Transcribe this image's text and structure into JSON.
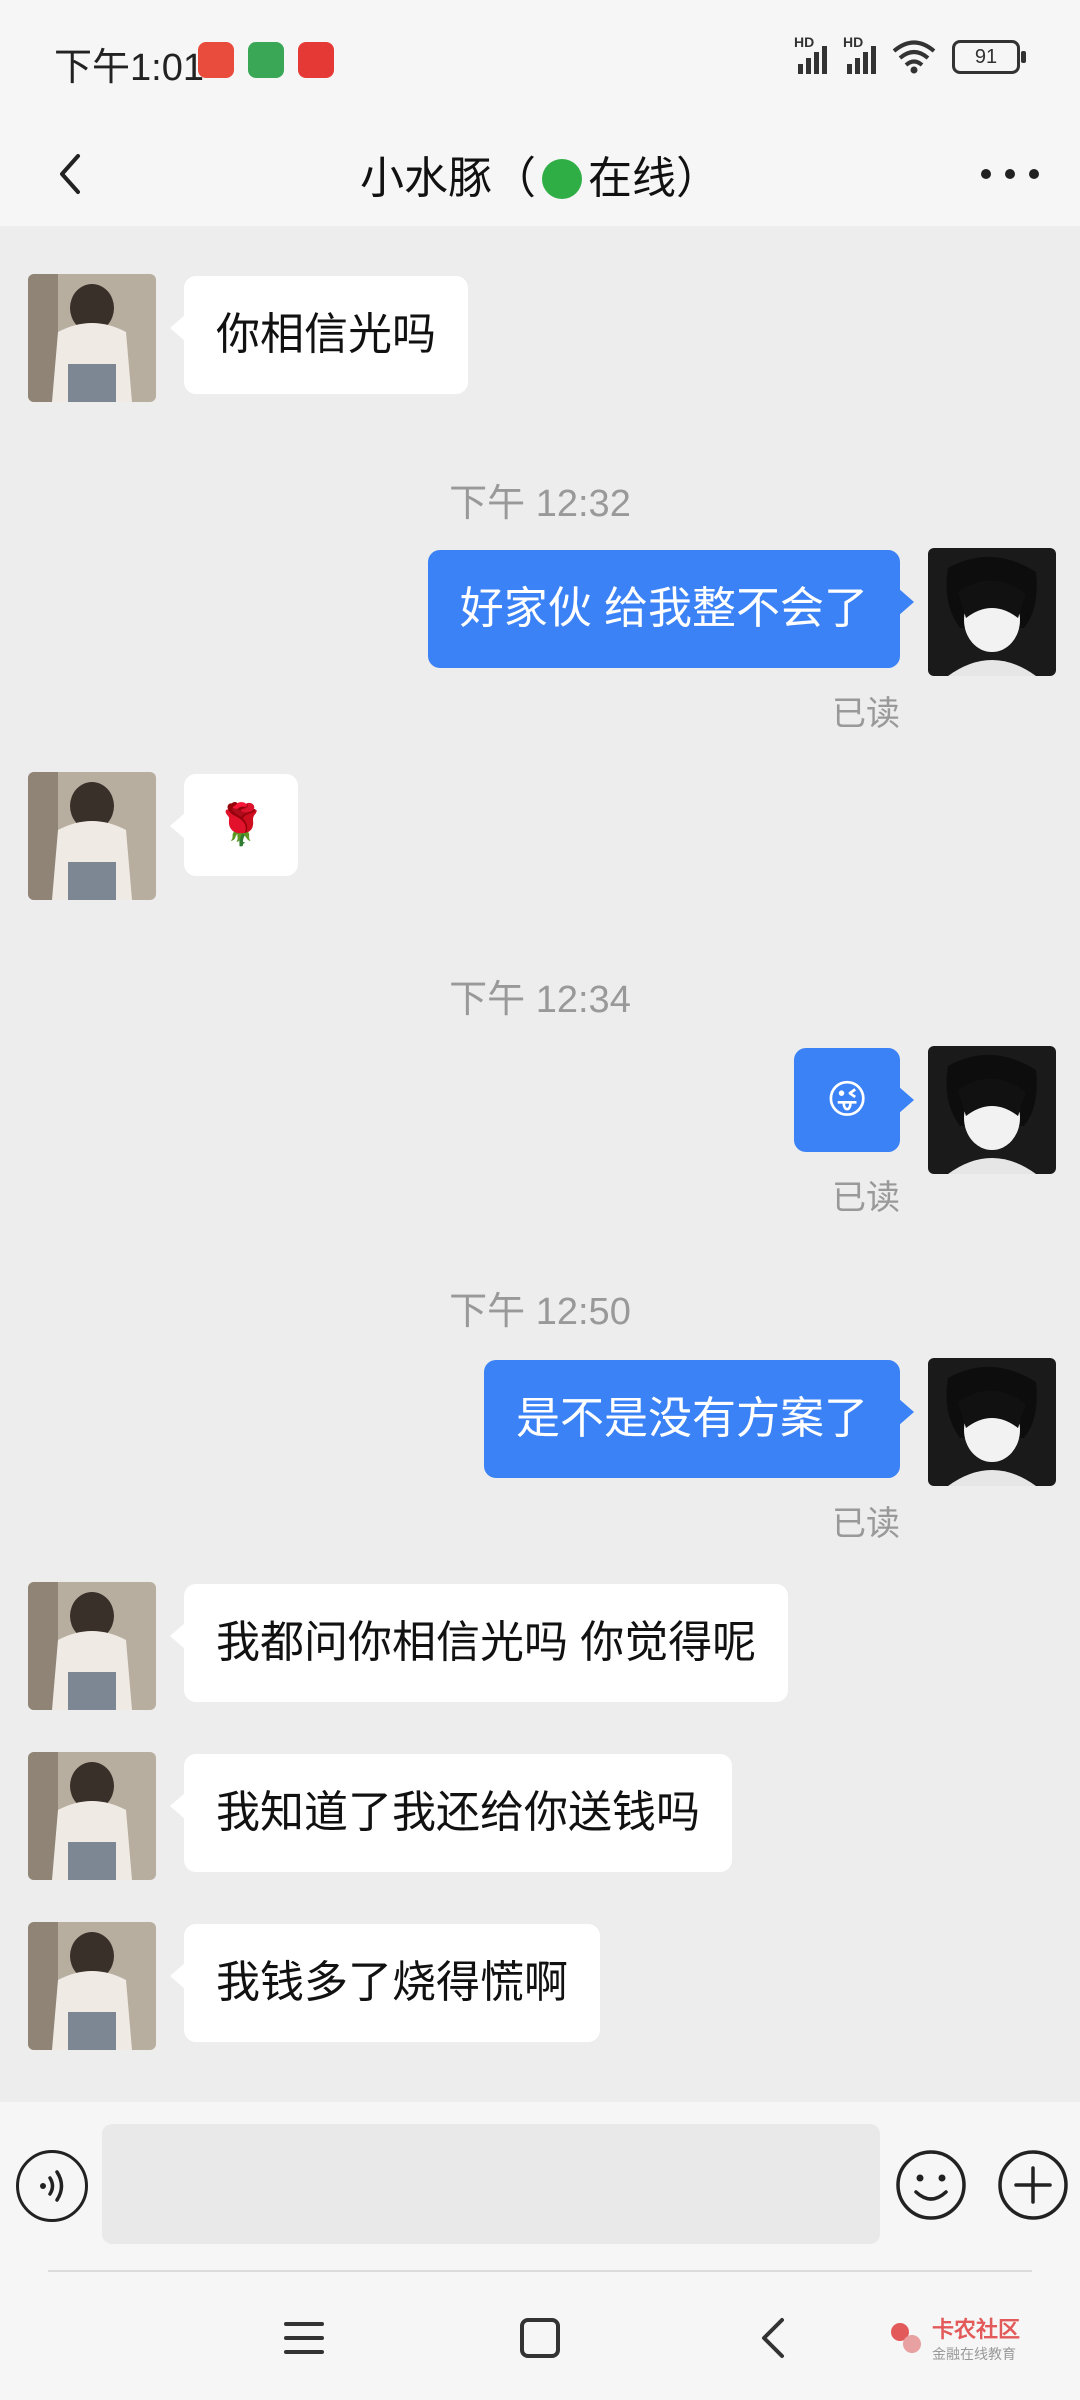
{
  "status_bar": {
    "time": "下午1:01",
    "app_icons": [
      "pinduoduo-icon",
      "app-icon",
      "search-app-icon"
    ],
    "signal1_label": "HD",
    "signal2_label": "HD",
    "battery_level": "91"
  },
  "header": {
    "name": "小水豚",
    "open_paren": "（",
    "status": "在线",
    "close_paren": "）",
    "status_color": "#2fae45"
  },
  "messages": [
    {
      "side": "left",
      "type": "text",
      "text": "你相信光吗"
    },
    {
      "timestamp": "下午 12:32"
    },
    {
      "side": "right",
      "type": "text",
      "text": "好家伙 给我整不会了",
      "read": "已读"
    },
    {
      "side": "left",
      "type": "emoji",
      "text": "🌹"
    },
    {
      "timestamp": "下午 12:34"
    },
    {
      "side": "right",
      "type": "emoji",
      "text": "😜",
      "read": "已读"
    },
    {
      "timestamp": "下午 12:50"
    },
    {
      "side": "right",
      "type": "text",
      "text": "是不是没有方案了",
      "read": "已读"
    },
    {
      "side": "left",
      "type": "text",
      "text": "我都问你相信光吗 你觉得呢"
    },
    {
      "side": "left",
      "type": "text",
      "text": "我知道了我还给你送钱吗"
    },
    {
      "side": "left",
      "type": "text",
      "text": "我钱多了烧得慌啊"
    }
  ],
  "input": {
    "value": "",
    "placeholder": ""
  },
  "watermark": {
    "line1": "卡农社区",
    "line2": "金融在线教育"
  },
  "colors": {
    "accent_bubble": "#3b82f6",
    "background": "#ededed",
    "bar": "#f6f6f6"
  }
}
